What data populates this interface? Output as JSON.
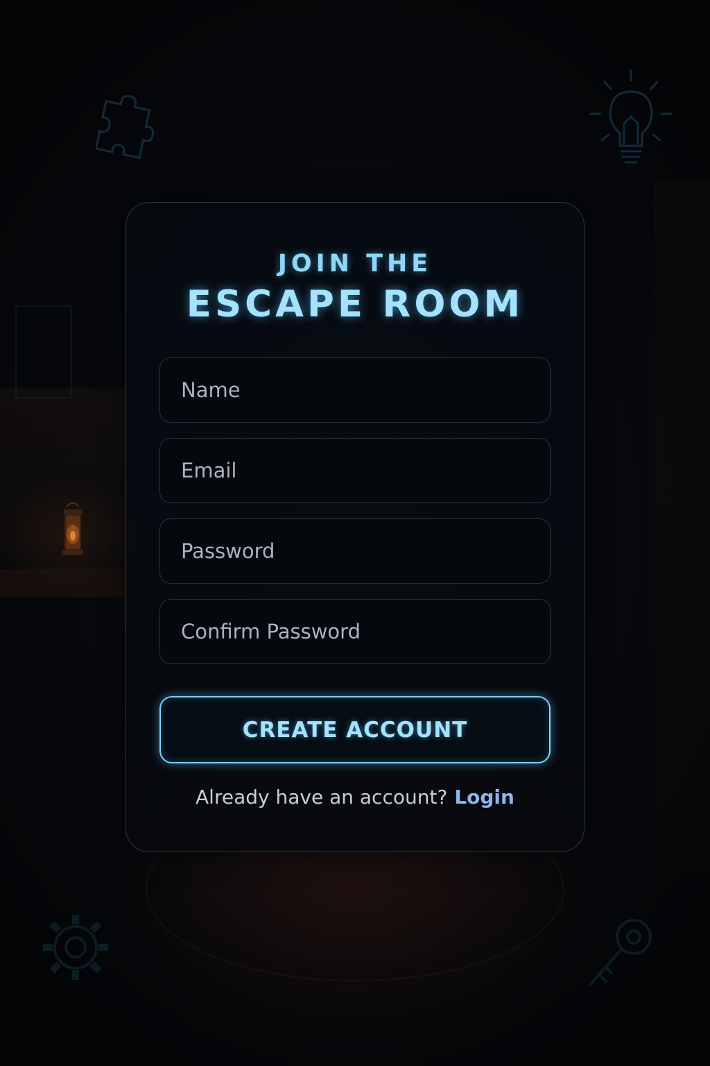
{
  "title": {
    "line1": "JOIN THE",
    "line2": "ESCAPE ROOM"
  },
  "form": {
    "name_placeholder": "Name",
    "email_placeholder": "Email",
    "password_placeholder": "Password",
    "confirm_password_placeholder": "Confirm Password",
    "name_value": "",
    "email_value": "",
    "password_value": "",
    "confirm_password_value": ""
  },
  "actions": {
    "create_label": "CREATE ACCOUNT"
  },
  "footer": {
    "prompt": "Already have an account?",
    "login_label": "Login"
  },
  "icons": {
    "top_left": "puzzle-icon",
    "top_right": "lightbulb-icon",
    "bottom_left": "gear-icon",
    "bottom_right": "key-icon"
  },
  "colors": {
    "accent": "#8fd6f7",
    "link": "#8fb4ef",
    "background": "#05070b"
  }
}
